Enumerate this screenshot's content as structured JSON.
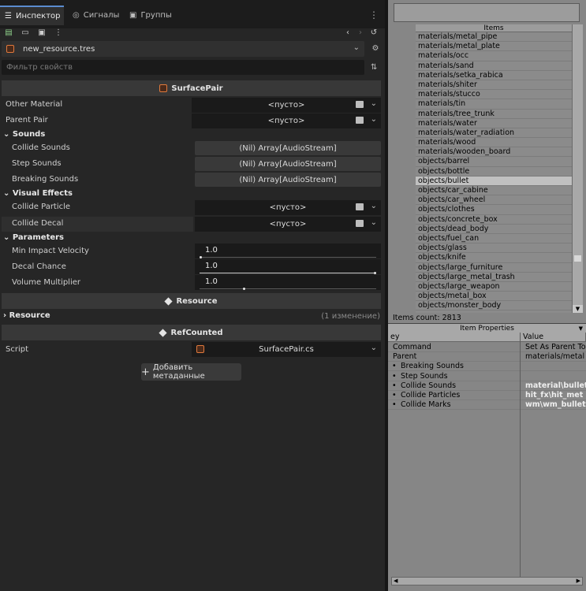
{
  "tabs": [
    {
      "label": "Инспектор",
      "icon": "inspector-icon"
    },
    {
      "label": "Сигналы",
      "icon": "signal-icon"
    },
    {
      "label": "Группы",
      "icon": "group-icon"
    }
  ],
  "resource": {
    "name": "new_resource.tres"
  },
  "filter": {
    "placeholder": "Фильтр свойств"
  },
  "sections": {
    "surfacepair": "SurfacePair",
    "resource": "Resource",
    "refcounted": "RefCounted"
  },
  "props": {
    "other_material": {
      "label": "Other Material",
      "value": "<пусто>"
    },
    "parent_pair": {
      "label": "Parent Pair",
      "value": "<пусто>"
    },
    "sounds_group": "Sounds",
    "collide_sounds": {
      "label": "Collide Sounds",
      "value": "(Nil) Array[AudioStream]"
    },
    "step_sounds": {
      "label": "Step Sounds",
      "value": "(Nil) Array[AudioStream]"
    },
    "breaking_sounds": {
      "label": "Breaking Sounds",
      "value": "(Nil) Array[AudioStream]"
    },
    "visual_group": "Visual Effects",
    "collide_particle": {
      "label": "Collide Particle",
      "value": "<пусто>"
    },
    "collide_decal": {
      "label": "Collide Decal",
      "value": "<пусто>"
    },
    "params_group": "Parameters",
    "min_impact": {
      "label": "Min Impact Velocity",
      "value": "1.0",
      "level": 0.0
    },
    "decal_chance": {
      "label": "Decal Chance",
      "value": "1.0",
      "level": 1.0
    },
    "volume_mult": {
      "label": "Volume Multiplier",
      "value": "1.0",
      "level": 0.25
    },
    "resource_row": {
      "label": "Resource",
      "note": "(1 изменение)"
    },
    "script": {
      "label": "Script",
      "value": "SurfacePair.cs"
    }
  },
  "add_metadata": "Добавить метаданные",
  "items_panel": {
    "header": "Items",
    "items": [
      "materials/metal_pipe",
      "materials/metal_plate",
      "materials/occ",
      "materials/sand",
      "materials/setka_rabica",
      "materials/shiter",
      "materials/stucco",
      "materials/tin",
      "materials/tree_trunk",
      "materials/water",
      "materials/water_radiation",
      "materials/wood",
      "materials/wooden_board",
      "objects/barrel",
      "objects/bottle",
      "objects/bullet",
      "objects/car_cabine",
      "objects/car_wheel",
      "objects/clothes",
      "objects/concrete_box",
      "objects/dead_body",
      "objects/fuel_can",
      "objects/glass",
      "objects/knife",
      "objects/large_furniture",
      "objects/large_metal_trash",
      "objects/large_weapon",
      "objects/metal_box",
      "objects/monster_body"
    ],
    "selected": "objects/bullet",
    "count": "Items count: 2813"
  },
  "item_properties": {
    "header": "Item Properties",
    "col_key": "ey",
    "col_value": "Value",
    "rows": [
      {
        "key": "Command",
        "value": "Set As Parent To"
      },
      {
        "key": "Parent",
        "value": "materials/metal"
      },
      {
        "key": "Breaking Sounds",
        "value": ""
      },
      {
        "key": "Step Sounds",
        "value": ""
      },
      {
        "key": "Collide Sounds",
        "value": "material\\bullet"
      },
      {
        "key": "Collide Particles",
        "value": "hit_fx\\hit_met"
      },
      {
        "key": "Collide Marks",
        "value": "wm\\wm_bullet"
      }
    ]
  }
}
